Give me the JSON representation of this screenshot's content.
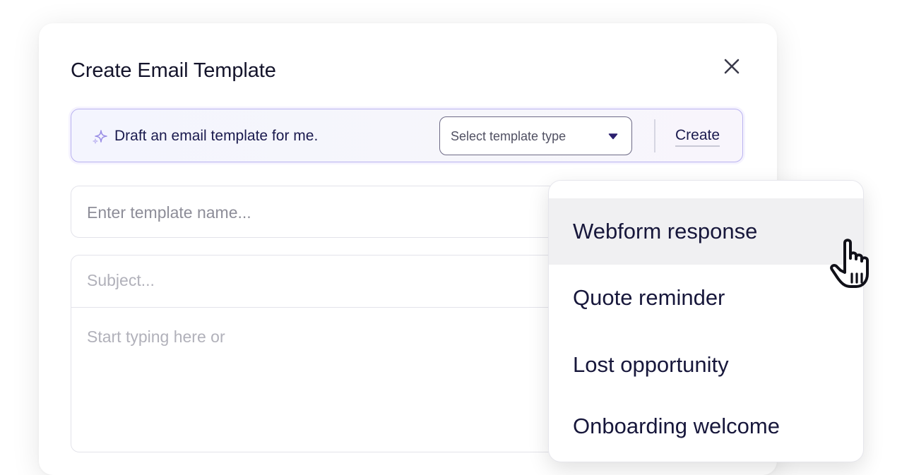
{
  "dialog": {
    "title": "Create Email Template"
  },
  "ai_bar": {
    "prompt": "Draft an email template for me.",
    "select_placeholder": "Select template type",
    "create_label": "Create"
  },
  "form": {
    "name_placeholder": "Enter template name...",
    "subject_placeholder": "Subject...",
    "body_placeholder": "Start typing here or"
  },
  "dropdown": {
    "options": [
      {
        "label": "Webform response",
        "highlighted": true
      },
      {
        "label": "Quote reminder",
        "highlighted": false
      },
      {
        "label": "Lost opportunity",
        "highlighted": false
      },
      {
        "label": "Onboarding welcome",
        "highlighted": false
      }
    ]
  },
  "icons": {
    "close": "close-icon",
    "sparkle": "sparkle-icon",
    "caret": "caret-down-icon",
    "cursor": "hand-pointer-cursor-icon"
  },
  "colors": {
    "accent_border": "#b9b2f0",
    "text_primary": "#14142b",
    "caret": "#2b1f6e",
    "highlight_bg": "#f0f0f2"
  }
}
